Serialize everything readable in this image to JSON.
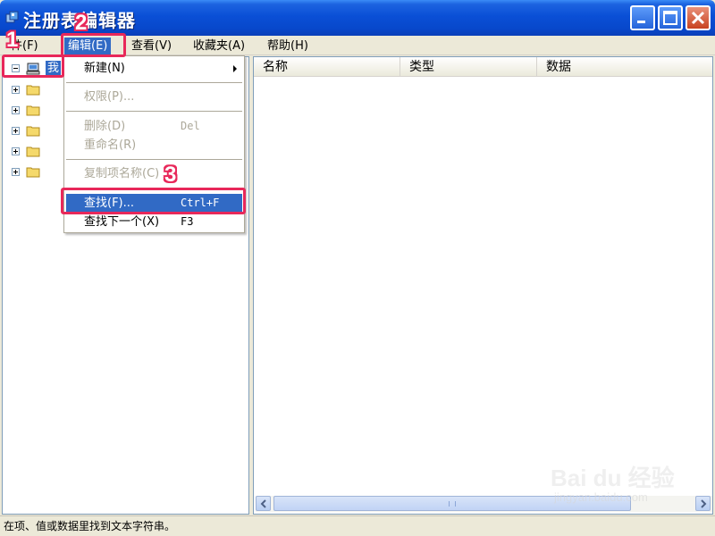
{
  "window": {
    "title": "注册表编辑器",
    "icons": {
      "app": "registry-icon",
      "minimize": "minimize-icon",
      "maximize": "maximize-icon",
      "close": "close-icon"
    }
  },
  "menubar": {
    "items": [
      {
        "label": "件(F)",
        "key": "file"
      },
      {
        "label": "编辑(E)",
        "key": "edit",
        "active": true
      },
      {
        "label": "查看(V)",
        "key": "view"
      },
      {
        "label": "收藏夹(A)",
        "key": "favorites"
      },
      {
        "label": "帮助(H)",
        "key": "help"
      }
    ]
  },
  "tree": {
    "root_label": "我",
    "icons": {
      "root": "computer-icon",
      "child": "folder-icon",
      "collapse": "minus-icon",
      "expand": "plus-icon"
    }
  },
  "edit_menu": {
    "items": [
      {
        "label": "新建(N)",
        "shortcut": "",
        "state": "normal",
        "submenu": true
      },
      {
        "label": "权限(P)...",
        "shortcut": "",
        "state": "disabled"
      },
      {
        "label": "删除(D)",
        "shortcut": "Del",
        "state": "disabled"
      },
      {
        "label": "重命名(R)",
        "shortcut": "",
        "state": "disabled"
      },
      {
        "label": "复制项名称(C)",
        "shortcut": "",
        "state": "disabled"
      },
      {
        "label": "查找(F)...",
        "shortcut": "Ctrl+F",
        "state": "highlighted"
      },
      {
        "label": "查找下一个(X)",
        "shortcut": "F3",
        "state": "normal"
      }
    ]
  },
  "list_view": {
    "columns": [
      "名称",
      "类型",
      "数据"
    ]
  },
  "statusbar": {
    "text": "在项、值或数据里找到文本字符串。"
  },
  "annotations": {
    "steps": [
      "1",
      "2",
      "3"
    ],
    "color": "#E8285A"
  },
  "watermark": {
    "brand": "Bai du 经验",
    "url": "jingyan.baidu.com"
  },
  "colors": {
    "titlebar": "#0A4FD6",
    "highlight": "#316AC5",
    "face": "#ECE9D8",
    "disabled_text": "#ACA899"
  }
}
